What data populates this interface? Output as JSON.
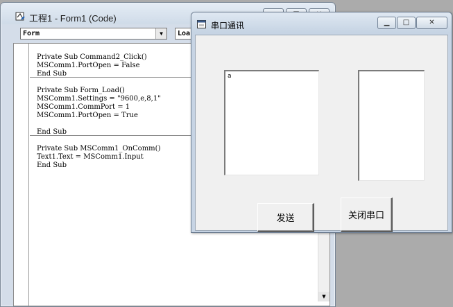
{
  "code_window": {
    "title": "工程1 - Form1 (Code)",
    "object_combo": "Form",
    "proc_combo": "Loa",
    "controls": {
      "minimize": "▁",
      "maximize": "□",
      "close": "✕"
    },
    "procedures": [
      {
        "lines": "Private Sub Command2_Click()\nMSComm1.PortOpen = False\nEnd Sub"
      },
      {
        "lines": "Private Sub Form_Load()\nMSComm1.Settings = \"9600,e,8,1\"\nMSComm1.CommPort = 1\nMSComm1.PortOpen = True\n\nEnd Sub"
      },
      {
        "lines": "Private Sub MSComm1_OnComm()\nText1.Text = MSComm1.Input\nEnd Sub"
      }
    ]
  },
  "serial_window": {
    "title": "串口通讯",
    "controls": {
      "minimize": "▁",
      "maximize": "□",
      "close": "✕"
    },
    "text1_value": "a",
    "text2_value": "",
    "send_button": "发送",
    "close_port_button": "关闭串口"
  },
  "icons": {
    "app": "vb-project-icon",
    "form": "form-icon",
    "dropdown": "chevron-down-icon"
  }
}
